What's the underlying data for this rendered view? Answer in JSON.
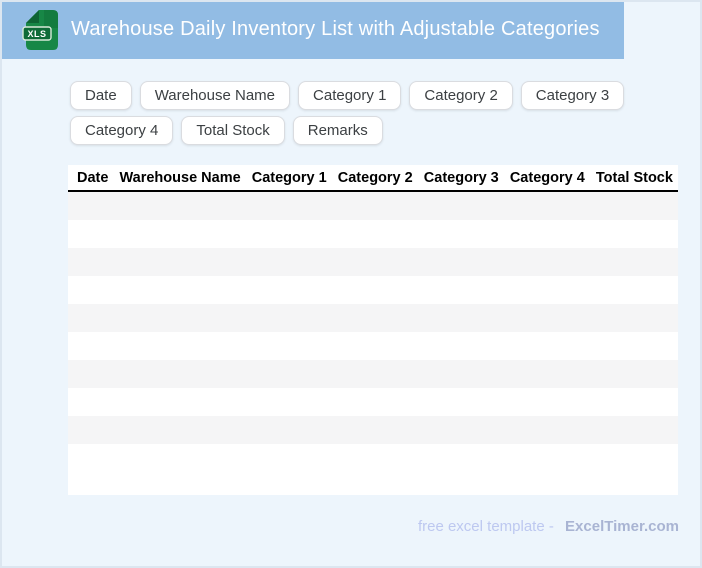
{
  "header": {
    "title": "Warehouse Daily Inventory List with Adjustable Categories",
    "icon": "xls-file-icon",
    "icon_label": "XLS",
    "bar_color": "#92bce4",
    "icon_green": "#178746",
    "icon_dark_green": "#0e6434"
  },
  "chips": [
    "Date",
    "Warehouse Name",
    "Category 1",
    "Category 2",
    "Category 3",
    "Category 4",
    "Total Stock",
    "Remarks"
  ],
  "table": {
    "columns": [
      "Date",
      "Warehouse Name",
      "Category 1",
      "Category 2",
      "Category 3",
      "Category 4",
      "Total Stock"
    ],
    "row_count": 10,
    "rows_empty": true,
    "stripe_color": "#f5f5f6"
  },
  "footer": {
    "tagline": "free excel template -",
    "brand": "ExcelTimer.com"
  },
  "colors": {
    "page_background": "#edf5fc",
    "page_border": "#dce6f0",
    "header_bar": "#92bce4",
    "chip_border": "#dadce0",
    "table_header_rule": "#000000"
  }
}
